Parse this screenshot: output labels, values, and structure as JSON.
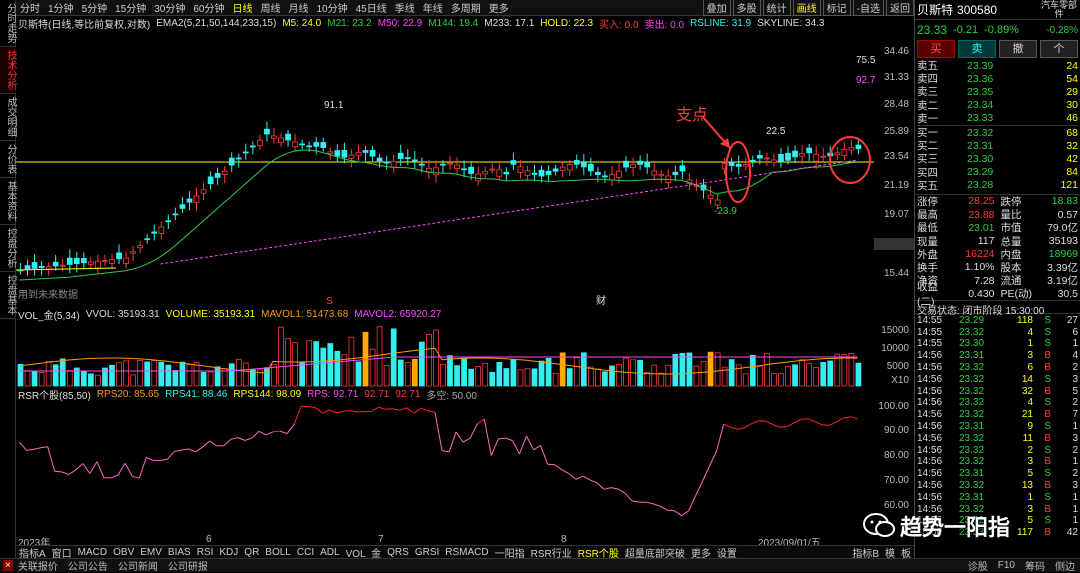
{
  "left_tabs": [
    "分时走势",
    "技术分析",
    "成交明细",
    "分价表",
    "基本资料",
    "控盘分析",
    "控盘基本"
  ],
  "period_tabs": [
    "分时",
    "1分钟",
    "5分钟",
    "15分钟",
    "30分钟",
    "60分钟",
    "日线",
    "周线",
    "月线",
    "10分钟",
    "45日线",
    "季线",
    "年线",
    "多周期",
    "更多"
  ],
  "period_active": "日线",
  "toolbar_right": [
    "叠加",
    "多股",
    "统计",
    "画线",
    "标记",
    "-自选",
    "返回"
  ],
  "main_indicator": {
    "title": "贝斯特(日线,等比前复权,对数)",
    "items": [
      {
        "text": "EMA2(5,21,50,144,233,15)",
        "color": "#dddddd"
      },
      {
        "text": "M5: 24.0",
        "color": "#ffff00"
      },
      {
        "text": "M21: 23.2",
        "color": "#2ecc40"
      },
      {
        "text": "M50: 22.9",
        "color": "#ff44ff"
      },
      {
        "text": "M144: 19.4",
        "color": "#2ecc40"
      },
      {
        "text": "M233: 17.1",
        "color": "#dddddd"
      },
      {
        "text": "HOLD: 22.3",
        "color": "#ffff00"
      },
      {
        "text": "买入: 0.0",
        "color": "#ff3b3b"
      },
      {
        "text": "卖出: 0.0",
        "color": "#ff44ff"
      },
      {
        "text": "RSLINE: 31.9",
        "color": "#33eeee"
      },
      {
        "text": "SKYLINE: 34.3",
        "color": "#dddddd"
      }
    ]
  },
  "price_axis": [
    "34.46",
    "31.33",
    "28.48",
    "25.89",
    "23.54",
    "21.19",
    "19.07",
    "16.88",
    "15.44"
  ],
  "price_labels": {
    "v755": "75.5",
    "v927": "92.7",
    "high_pct": "91.1",
    "recent_high": "22.5",
    "low_mark": "-23.9",
    "cur_tag": "16.88",
    "note": "用到未来数据",
    "support": "支点"
  },
  "chart_markers": [
    "S",
    "财"
  ],
  "volume_indicator": {
    "items": [
      {
        "text": "VOL_金(5,34)",
        "color": "#dddddd"
      },
      {
        "text": "VVOL: 35193.31",
        "color": "#dddddd"
      },
      {
        "text": "VOLUME: 35193.31",
        "color": "#ffff00"
      },
      {
        "text": "MAVOL1: 51473.68",
        "color": "#ff9900"
      },
      {
        "text": "MAVOL2: 65920.27",
        "color": "#ff44ff"
      }
    ],
    "axis": [
      "15000",
      "10000",
      "5000",
      "X10"
    ]
  },
  "rsr_indicator": {
    "items": [
      {
        "text": "RSR个股(85,50)",
        "color": "#dddddd"
      },
      {
        "text": "RPS20: 85.65",
        "color": "#ff9900"
      },
      {
        "text": "RPS41: 88.46",
        "color": "#33eeee"
      },
      {
        "text": "RPS144: 98.09",
        "color": "#ffff00"
      },
      {
        "text": "RPS: 92.71",
        "color": "#ff44ff"
      },
      {
        "text": "92.71",
        "color": "#ff3b3b"
      },
      {
        "text": "92.71",
        "color": "#ff3b3b"
      },
      {
        "text": "多空: 50.00",
        "color": "#aaaaaa"
      }
    ],
    "axis": [
      "100.00",
      "90.00",
      "80.00",
      "70.00",
      "60.00"
    ]
  },
  "x_axis": [
    "2023年",
    "6",
    "7",
    "8",
    "2023/09/01/五"
  ],
  "bottom_tabs": [
    "指标A",
    "窗口",
    "MACD",
    "OBV",
    "EMV",
    "BIAS",
    "RSI",
    "KDJ",
    "QR",
    "BOLL",
    "CCI",
    "ADL",
    "VOL_金",
    "QRS",
    "GRSI",
    "RSMACD",
    "一阳指",
    "RSR行业",
    "RSR个股",
    "超量底部突破",
    "更多",
    "设置"
  ],
  "bottom_active": "RSR个股",
  "bottom_right": [
    "指标B",
    "模",
    "板"
  ],
  "status_bar": [
    "关联报价",
    "公司公告",
    "公司新闻",
    "公司研报"
  ],
  "status_right": [
    "诊股",
    "F10",
    "筹码",
    "侧边"
  ],
  "watermark": "趋势一阳指",
  "stock": {
    "name": "贝斯特",
    "code": "300580",
    "sector": "汽车零部件",
    "sector_pct": "-0.28%",
    "price": "23.33",
    "change": "-0.21",
    "pct": "-0.89%",
    "buy_btn": "买",
    "sell_btn": "卖",
    "cancel_btn": "撤",
    "chip_btn": "个"
  },
  "order_book": {
    "asks": [
      [
        "卖五",
        "23.39",
        "24"
      ],
      [
        "卖四",
        "23.36",
        "54"
      ],
      [
        "卖三",
        "23.35",
        "29"
      ],
      [
        "卖二",
        "23.34",
        "30"
      ],
      [
        "卖一",
        "23.33",
        "46"
      ]
    ],
    "bids": [
      [
        "买一",
        "23.32",
        "68"
      ],
      [
        "买二",
        "23.31",
        "32"
      ],
      [
        "买三",
        "23.30",
        "42"
      ],
      [
        "买四",
        "23.29",
        "84"
      ],
      [
        "买五",
        "23.28",
        "121"
      ]
    ]
  },
  "quote": [
    [
      [
        "涨停",
        "28.25",
        "red"
      ],
      [
        "跌停",
        "18.83",
        "green"
      ]
    ],
    [
      [
        "最高",
        "23.88",
        "red"
      ],
      [
        "量比",
        "0.57",
        "white"
      ]
    ],
    [
      [
        "最低",
        "23.01",
        "green"
      ],
      [
        "市值",
        "79.0亿",
        "white"
      ]
    ],
    [
      [
        "现量",
        "117",
        "white"
      ],
      [
        "总量",
        "35193",
        "white"
      ]
    ],
    [
      [
        "外盘",
        "16224",
        "red"
      ],
      [
        "内盘",
        "18969",
        "green"
      ]
    ],
    [
      [
        "换手",
        "1.10%",
        "white"
      ],
      [
        "股本",
        "3.39亿",
        "white"
      ]
    ],
    [
      [
        "净资",
        "7.28",
        "white"
      ],
      [
        "流通",
        "3.19亿",
        "white"
      ]
    ],
    [
      [
        "收益(二)",
        "0.430",
        "white"
      ],
      [
        "PE(动)",
        "30.5",
        "white"
      ]
    ]
  ],
  "trade_status": "交易状态: 闭市阶段 15:30:00",
  "ticks": [
    [
      "14:55",
      "23.29",
      "118",
      "S",
      "27"
    ],
    [
      "14:55",
      "23.32",
      "4",
      "S",
      "6"
    ],
    [
      "14:55",
      "23.30",
      "1",
      "S",
      "1"
    ],
    [
      "14:56",
      "23.31",
      "3",
      "B",
      "4"
    ],
    [
      "14:56",
      "23.32",
      "6",
      "B",
      "2"
    ],
    [
      "14:56",
      "23.32",
      "14",
      "S",
      "3"
    ],
    [
      "14:56",
      "23.32",
      "32",
      "B",
      "5"
    ],
    [
      "14:56",
      "23.32",
      "4",
      "S",
      "2"
    ],
    [
      "14:56",
      "23.32",
      "21",
      "B",
      "7"
    ],
    [
      "14:56",
      "23.31",
      "9",
      "S",
      "1"
    ],
    [
      "14:56",
      "23.32",
      "11",
      "B",
      "3"
    ],
    [
      "14:56",
      "23.32",
      "2",
      "S",
      "2"
    ],
    [
      "14:56",
      "23.32",
      "3",
      "B",
      "1"
    ],
    [
      "14:56",
      "23.31",
      "5",
      "S",
      "2"
    ],
    [
      "14:56",
      "23.32",
      "13",
      "B",
      "3"
    ],
    [
      "14:56",
      "23.31",
      "1",
      "S",
      "1"
    ],
    [
      "14:56",
      "23.32",
      "3",
      "B",
      "1"
    ],
    [
      "14:56",
      "23.32",
      "5",
      "S",
      "1"
    ],
    [
      "15:00",
      "23.33",
      "117",
      "B",
      "42"
    ]
  ],
  "colors": {
    "up": "#ff3b3b",
    "down": "#33eeee",
    "bg": "#000000"
  }
}
